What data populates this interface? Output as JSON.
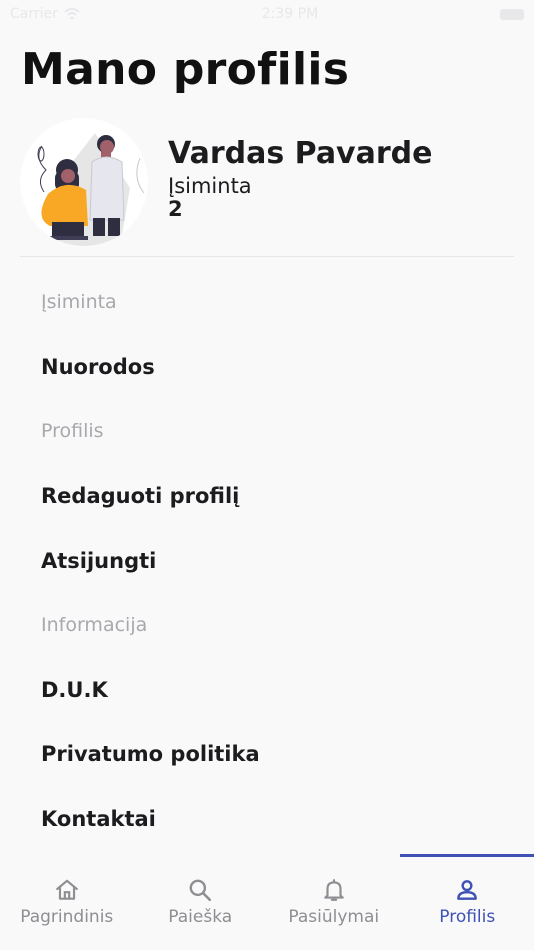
{
  "status_bar": {
    "carrier": "Carrier",
    "time": "2:39 PM"
  },
  "page_title": "Mano profilis",
  "profile": {
    "name": "Vardas Pavarde",
    "saved_label": "Įsiminta",
    "saved_count": "2"
  },
  "menu": {
    "section_saved": "Įsiminta",
    "links": "Nuorodos",
    "section_profile": "Profilis",
    "edit_profile": "Redaguoti profilį",
    "logout": "Atsijungti",
    "section_info": "Informacija",
    "faq": "D.U.K",
    "privacy": "Privatumo politika",
    "contacts": "Kontaktai"
  },
  "tabs": [
    {
      "label": "Pagrindinis",
      "icon": "home-icon"
    },
    {
      "label": "Paieška",
      "icon": "search-icon"
    },
    {
      "label": "Pasiūlymai",
      "icon": "bell-icon"
    },
    {
      "label": "Profilis",
      "icon": "user-icon"
    }
  ],
  "active_tab": "Profilis",
  "colors": {
    "accent": "#3f51b5",
    "background": "#f9f9fa",
    "muted_text": "#a8a8ad",
    "tab_inactive": "#8e8e93"
  }
}
